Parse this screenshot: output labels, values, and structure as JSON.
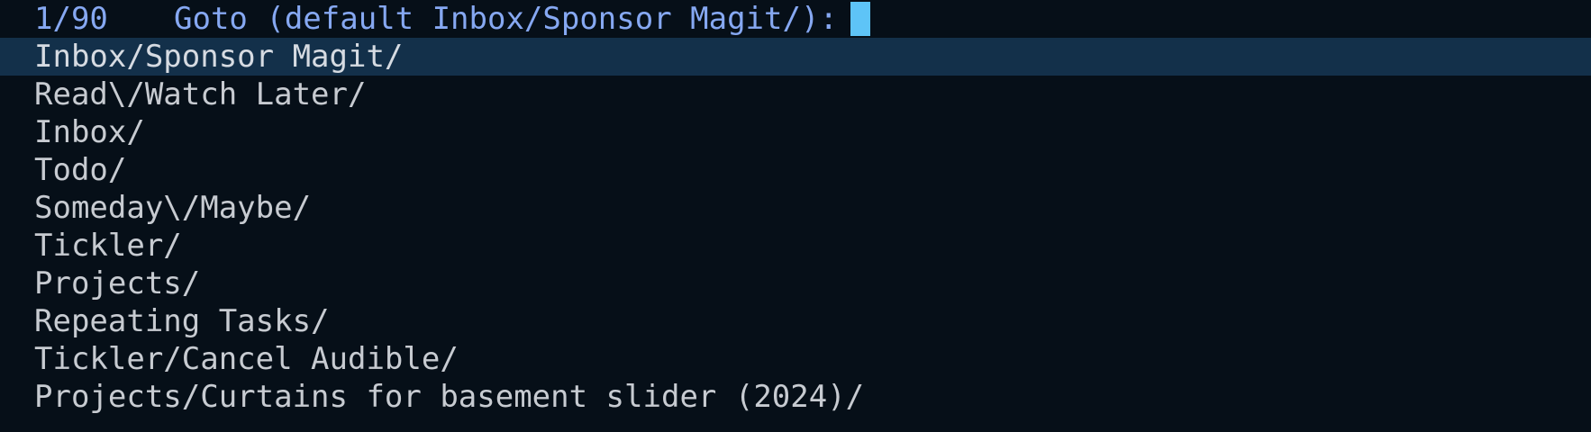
{
  "prompt": {
    "count": "1/90",
    "text": "Goto (default Inbox/Sponsor Magit/):",
    "input_value": ""
  },
  "candidates": [
    {
      "label": "Inbox/Sponsor Magit/",
      "selected": true
    },
    {
      "label": "Read\\/Watch Later/",
      "selected": false
    },
    {
      "label": "Inbox/",
      "selected": false
    },
    {
      "label": "Todo/",
      "selected": false
    },
    {
      "label": "Someday\\/Maybe/",
      "selected": false
    },
    {
      "label": "Tickler/",
      "selected": false
    },
    {
      "label": "Projects/",
      "selected": false
    },
    {
      "label": "Repeating Tasks/",
      "selected": false
    },
    {
      "label": "Tickler/Cancel Audible/",
      "selected": false
    },
    {
      "label": "Projects/Curtains for basement slider (2024)/",
      "selected": false
    }
  ],
  "colors": {
    "background": "#060f18",
    "prompt": "#86a8f2",
    "cursor": "#5ec4f7",
    "selection": "#13304a",
    "text": "#c7cbd1"
  }
}
